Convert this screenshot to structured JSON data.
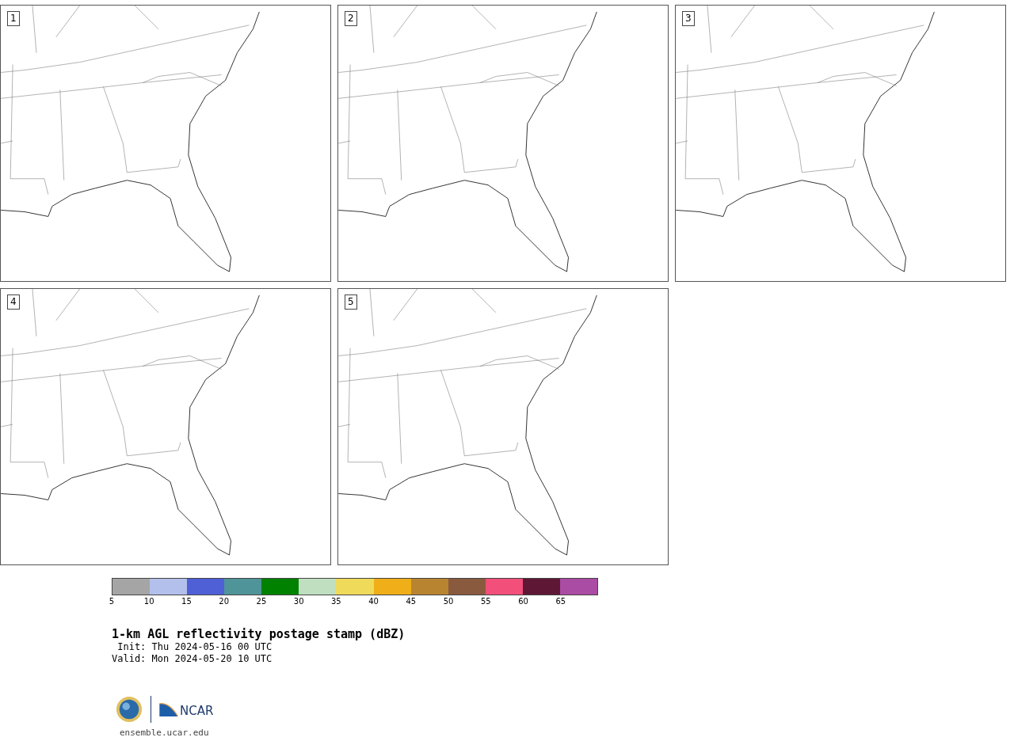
{
  "panels": [
    {
      "number": "1"
    },
    {
      "number": "2"
    },
    {
      "number": "3"
    },
    {
      "number": "4"
    },
    {
      "number": "5"
    }
  ],
  "colorbar": {
    "segments": [
      {
        "color": "#a5a5a5"
      },
      {
        "color": "#b4c0ec"
      },
      {
        "color": "#4f5fd6"
      },
      {
        "color": "#4f9499"
      },
      {
        "color": "#008200"
      },
      {
        "color": "#c0dfc0"
      },
      {
        "color": "#f0da5a"
      },
      {
        "color": "#f0ae18"
      },
      {
        "color": "#b98430"
      },
      {
        "color": "#8a5a3e"
      },
      {
        "color": "#f24f7b"
      },
      {
        "color": "#5e1734"
      },
      {
        "color": "#aa4ba4"
      }
    ],
    "ticks": [
      "5",
      "10",
      "15",
      "20",
      "25",
      "30",
      "35",
      "40",
      "45",
      "50",
      "55",
      "60",
      "65"
    ]
  },
  "title": "1-km AGL reflectivity postage stamp (dBZ)",
  "init": " Init: Thu 2024-05-16 00 UTC",
  "valid": "Valid: Mon 2024-05-20 10 UTC",
  "logo": {
    "text": "NCAR",
    "url": "ensemble.ucar.edu"
  }
}
